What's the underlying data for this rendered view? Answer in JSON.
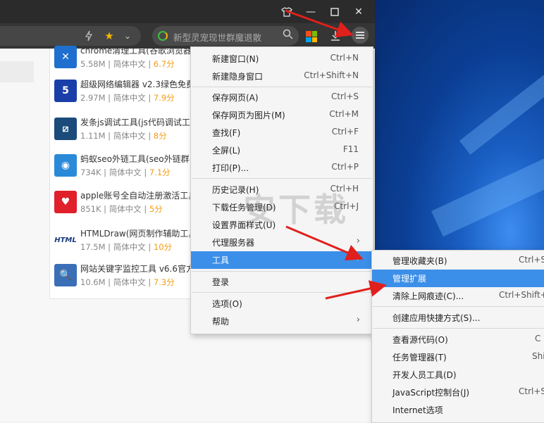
{
  "titlebar": {
    "shirt_icon": "shirt-icon",
    "min_icon": "minimize-icon",
    "max_icon": "maximize-icon",
    "close_icon": "close-icon"
  },
  "addressbar": {
    "search_placeholder": "新型灵宠现世群魔退散",
    "icons": [
      "lightning-icon",
      "star-icon",
      "chevron-down-icon",
      "search-icon",
      "apps-icon",
      "download-icon",
      "menu-icon"
    ]
  },
  "list": [
    {
      "name": "chrome清理工具(谷歌浏览器",
      "size": "5.58M",
      "lang": "简体中文",
      "score": "6.7分",
      "icon_color": "#1f6fcf",
      "icon_glyph": "✕"
    },
    {
      "name": "超级网络编辑器 v2.3绿色免费",
      "size": "2.97M",
      "lang": "简体中文",
      "score": "7.9分",
      "icon_color": "#1a3fa8",
      "icon_glyph": "5"
    },
    {
      "name": "发条js调试工具(js代码调试工",
      "size": "1.11M",
      "lang": "简体中文",
      "score": "8分",
      "icon_color": "#1a4b7a",
      "icon_glyph": "⧄"
    },
    {
      "name": "蚂蚁seo外链工具(seo外链群",
      "size": "734K",
      "lang": "简体中文",
      "score": "7.1分",
      "icon_color": "#2a8ad8",
      "icon_glyph": "◉"
    },
    {
      "name": "apple账号全自动注册激活工具",
      "size": "851K",
      "lang": "简体中文",
      "score": "5分",
      "icon_color": "#e0202a",
      "icon_glyph": "♥"
    },
    {
      "name": "HTMLDraw(网页制作辅助工具",
      "size": "17.5M",
      "lang": "简体中文",
      "score": "10分",
      "icon_color": "#ffffff",
      "icon_glyph": "HTML"
    },
    {
      "name": "网站关键字监控工具 v6.6官方",
      "size": "10.6M",
      "lang": "简体中文",
      "score": "7.3分",
      "icon_color": "#3a6fb8",
      "icon_glyph": "🔍"
    }
  ],
  "menu": [
    {
      "label": "新建窗口(N)",
      "shortcut": "Ctrl+N"
    },
    {
      "label": "新建隐身窗口",
      "shortcut": "Ctrl+Shift+N"
    },
    {
      "label": "保存网页(A)",
      "shortcut": "Ctrl+S"
    },
    {
      "label": "保存网页为图片(M)",
      "shortcut": "Ctrl+M"
    },
    {
      "label": "查找(F)",
      "shortcut": "Ctrl+F"
    },
    {
      "label": "全屏(L)",
      "shortcut": "F11"
    },
    {
      "label": "打印(P)...",
      "shortcut": "Ctrl+P"
    },
    {
      "label": "历史记录(H)",
      "shortcut": "Ctrl+H"
    },
    {
      "label": "下载任务管理(D)",
      "shortcut": "Ctrl+J"
    },
    {
      "label": "设置界面样式(U)",
      "shortcut": ""
    },
    {
      "label": "代理服务器",
      "shortcut": ""
    },
    {
      "label": "工具",
      "shortcut": ""
    },
    {
      "label": "登录",
      "shortcut": ""
    },
    {
      "label": "选项(O)",
      "shortcut": ""
    },
    {
      "label": "帮助",
      "shortcut": ""
    }
  ],
  "submenu": [
    {
      "label": "管理收藏夹(B)",
      "shortcut": "Ctrl+S"
    },
    {
      "label": "管理扩展",
      "shortcut": ""
    },
    {
      "label": "清除上网痕迹(C)...",
      "shortcut": "Ctrl+Shift+"
    },
    {
      "label": "创建应用快捷方式(S)...",
      "shortcut": ""
    },
    {
      "label": "查看源代码(O)",
      "shortcut": "C"
    },
    {
      "label": "任务管理器(T)",
      "shortcut": "Shi"
    },
    {
      "label": "开发人员工具(D)",
      "shortcut": ""
    },
    {
      "label": "JavaScript控制台(J)",
      "shortcut": "Ctrl+S"
    },
    {
      "label": "Internet选项",
      "shortcut": ""
    }
  ],
  "watermark": "安下载",
  "colors": {
    "accent": "#3b8fe8",
    "arrow": "#e0201c",
    "score": "#f39c12"
  }
}
